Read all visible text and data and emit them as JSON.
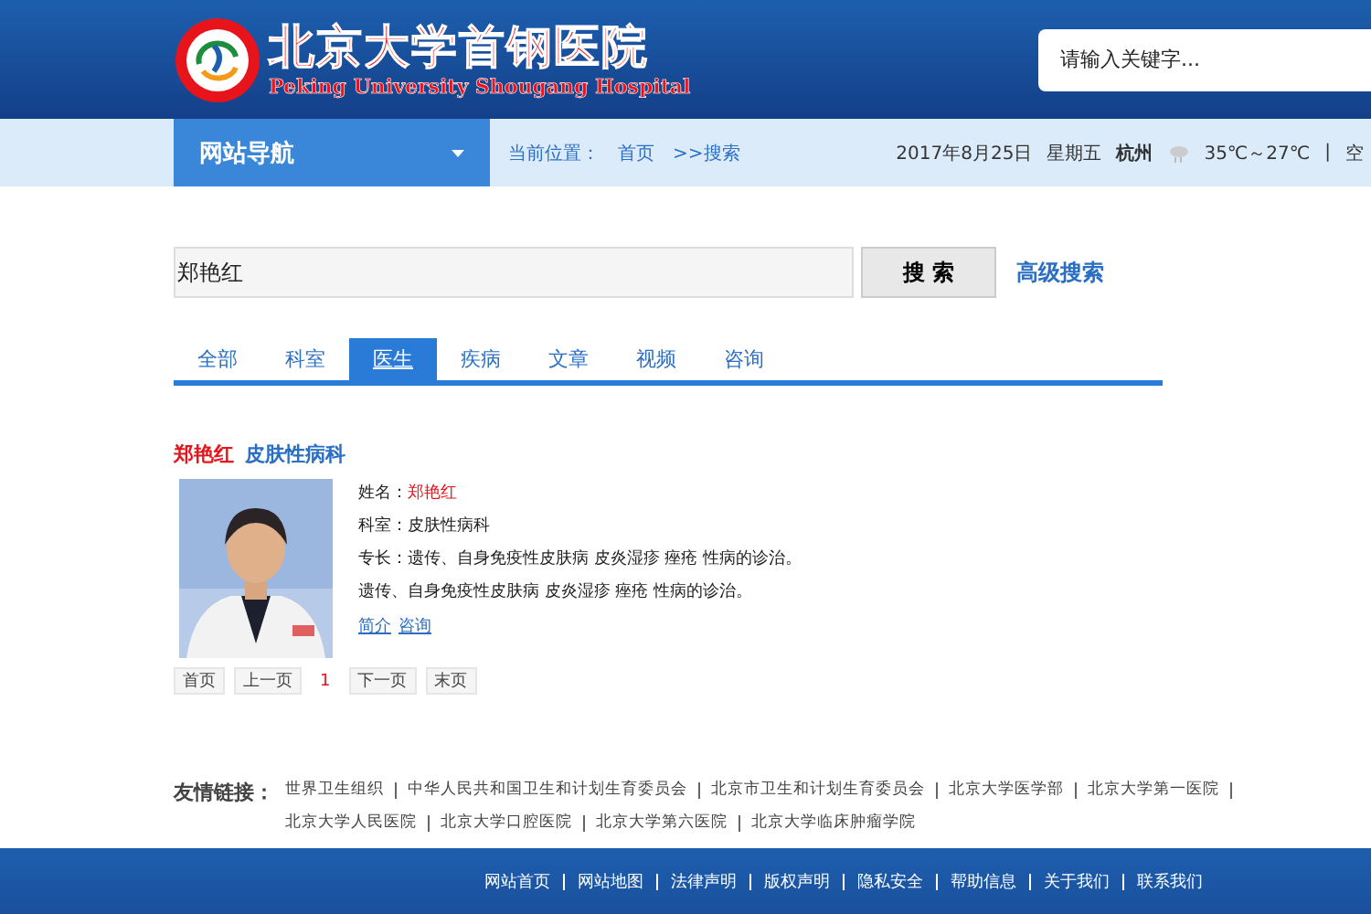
{
  "header": {
    "logo_cn": "北京大学首钢医院",
    "logo_en": "Peking University Shougang Hospital",
    "search": {
      "placeholder": "请输入关键字..."
    }
  },
  "navbar": {
    "menu": "网站导航",
    "location_label": "当前位置：",
    "breadcrumbs": [
      "首页",
      ">>搜索"
    ],
    "date": "2017年8月25日",
    "weekday": "星期五",
    "city": "杭州",
    "temperature": "35℃～27℃",
    "separator": "|",
    "extra": "空"
  },
  "search": {
    "value": "郑艳红",
    "button": "搜 索",
    "advanced": "高级搜索"
  },
  "tabs": [
    {
      "label": "全部",
      "selected": false
    },
    {
      "label": "科室",
      "selected": false
    },
    {
      "label": "医生",
      "selected": true
    },
    {
      "label": "疾病",
      "selected": false
    },
    {
      "label": "文章",
      "selected": false
    },
    {
      "label": "视频",
      "selected": false
    },
    {
      "label": "咨询",
      "selected": false
    }
  ],
  "result": {
    "name": "郑艳红",
    "department": "皮肤性病科",
    "fields": [
      {
        "label": "姓名：",
        "value": "郑艳红",
        "kind": "highlight"
      },
      {
        "label": "科室：",
        "value": "皮肤性病科",
        "kind": "plain"
      },
      {
        "label": "专长：",
        "value": "遗传、自身免疫性皮肤病 皮炎湿疹 痤疮 性病的诊治。",
        "kind": "plain"
      }
    ],
    "summary": "遗传、自身免疫性皮肤病 皮炎湿疹 痤疮 性病的诊治。",
    "links": [
      "简介",
      "咨询"
    ]
  },
  "pagination": [
    {
      "label": "首页",
      "kind": "button"
    },
    {
      "label": "上一页",
      "kind": "button"
    },
    {
      "label": "1",
      "kind": "current"
    },
    {
      "label": "下一页",
      "kind": "button"
    },
    {
      "label": "末页",
      "kind": "button"
    }
  ],
  "friend_links": {
    "label": "友情链接：",
    "links": [
      "世界卫生组织",
      "中华人民共和国卫生和计划生育委员会",
      "北京市卫生和计划生育委员会",
      "北京大学医学部",
      "北京大学第一医院",
      "北京大学人民医院",
      "北京大学口腔医院",
      "北京大学第六医院",
      "北京大学临床肿瘤学院"
    ]
  },
  "footer": {
    "links": [
      "网站首页",
      "网站地图",
      "法律声明",
      "版权声明",
      "隐私安全",
      "帮助信息",
      "关于我们",
      "联系我们"
    ]
  }
}
